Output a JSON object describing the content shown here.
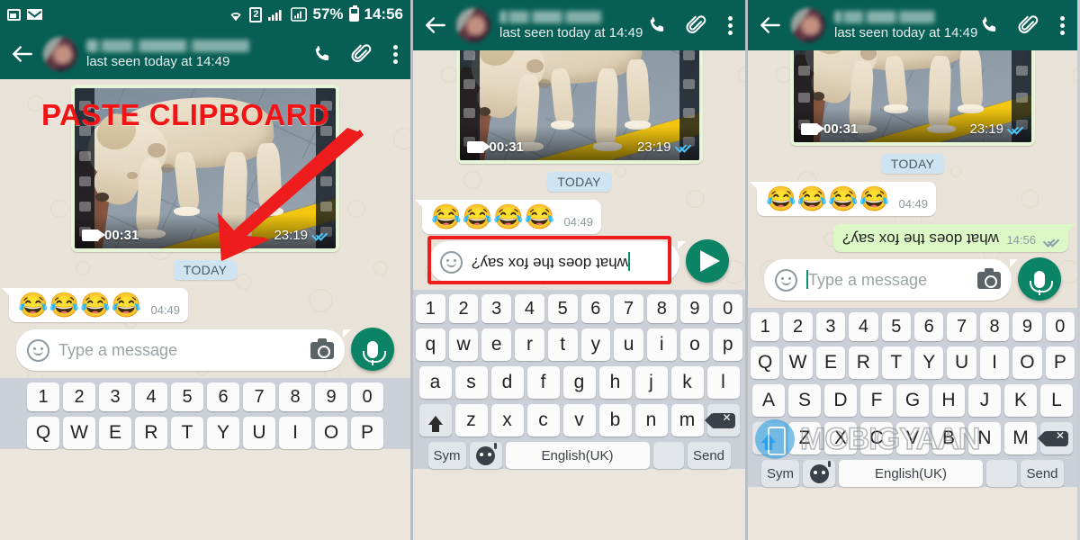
{
  "meta": {
    "app": "WhatsApp",
    "screenshot_kind": "3-panel mobile tutorial",
    "watermark": "MOBIGYAAN"
  },
  "colors": {
    "header_green": "#075e54",
    "chat_bg": "#e9e2d8",
    "outgoing_bubble": "#dcf8c6",
    "incoming_bubble": "#ffffff",
    "accent_teal": "#0b8466",
    "annotation_red": "#ee1c1c",
    "daychip_blue": "#cfe4f2",
    "tick_blue": "#4fc3f7",
    "keyboard_bg": "#cbd0d8",
    "shift_active_blue": "#2a9df4"
  },
  "statusbar": {
    "icons_left": [
      "screenshot-icon",
      "envelope-icon"
    ],
    "wifi": "wifi-icon",
    "sim": "2",
    "signal_1": "signal-bars-icon",
    "signal_2": "signal-bars-boxed-icon",
    "battery_percent": "57%",
    "battery": "battery-icon",
    "clock": "14:56"
  },
  "header": {
    "back": "back-arrow-icon",
    "avatar": "contact-avatar",
    "contact_name": "",
    "status": "last seen today at 14:49",
    "call": "phone-call-icon",
    "attach": "paperclip-icon",
    "menu": "overflow-menu-icon"
  },
  "video_message": {
    "duration": "00:31",
    "time": "23:19",
    "receipt": "delivered-read-double-check",
    "camera_icon": "video-camera-icon"
  },
  "day_divider": "TODAY",
  "messages": {
    "emoji_bubble": {
      "content": "😂😂😂😂",
      "time": "04:49",
      "direction": "incoming"
    },
    "sent_bubble": {
      "content": "what does the fox say?",
      "rendered": "upside-down",
      "time": "14:56",
      "direction": "outgoing",
      "receipt": "delivered-read-double-check"
    }
  },
  "composer": {
    "emoji_icon": "smiley-icon",
    "placeholder": "Type a message",
    "typed_value": "what does the fox say?",
    "typed_rendered": "upside-down",
    "camera_icon": "camera-icon",
    "mic_icon": "microphone-icon",
    "send_icon": "send-plane-icon"
  },
  "annotation": {
    "label": "PASTE CLIPBOARD",
    "arrow": "red-arrow-pointing-down-left"
  },
  "keyboard": {
    "numbers": [
      "1",
      "2",
      "3",
      "4",
      "5",
      "6",
      "7",
      "8",
      "9",
      "0"
    ],
    "row1_upper": [
      "Q",
      "W",
      "E",
      "R",
      "T",
      "Y",
      "U",
      "I",
      "O",
      "P"
    ],
    "row1_lower": [
      "q",
      "w",
      "e",
      "r",
      "t",
      "y",
      "u",
      "i",
      "o",
      "p"
    ],
    "row2_upper": [
      "A",
      "S",
      "D",
      "F",
      "G",
      "H",
      "J",
      "K",
      "L"
    ],
    "row2_lower": [
      "a",
      "s",
      "d",
      "f",
      "g",
      "h",
      "j",
      "k",
      "l"
    ],
    "row3_upper": [
      "Z",
      "X",
      "C",
      "V",
      "B",
      "N",
      "M"
    ],
    "row3_lower": [
      "z",
      "x",
      "c",
      "v",
      "b",
      "n",
      "m"
    ],
    "shift": "shift-key",
    "backspace": "backspace-key",
    "sym": "Sym",
    "emoji_key": "emoji-key",
    "space_label": "English(UK)",
    "blank": "",
    "send": "Send"
  },
  "panels": [
    {
      "id": "panel-1",
      "caption_overlay": "PASTE CLIPBOARD",
      "input_state": "empty",
      "shift_active": false,
      "case": "upper"
    },
    {
      "id": "panel-2",
      "caption_overlay": "",
      "input_state": "typed-upside-down",
      "shift_active": false,
      "case": "lower"
    },
    {
      "id": "panel-3",
      "caption_overlay": "",
      "input_state": "empty-sent",
      "shift_active": true,
      "case": "upper"
    }
  ]
}
